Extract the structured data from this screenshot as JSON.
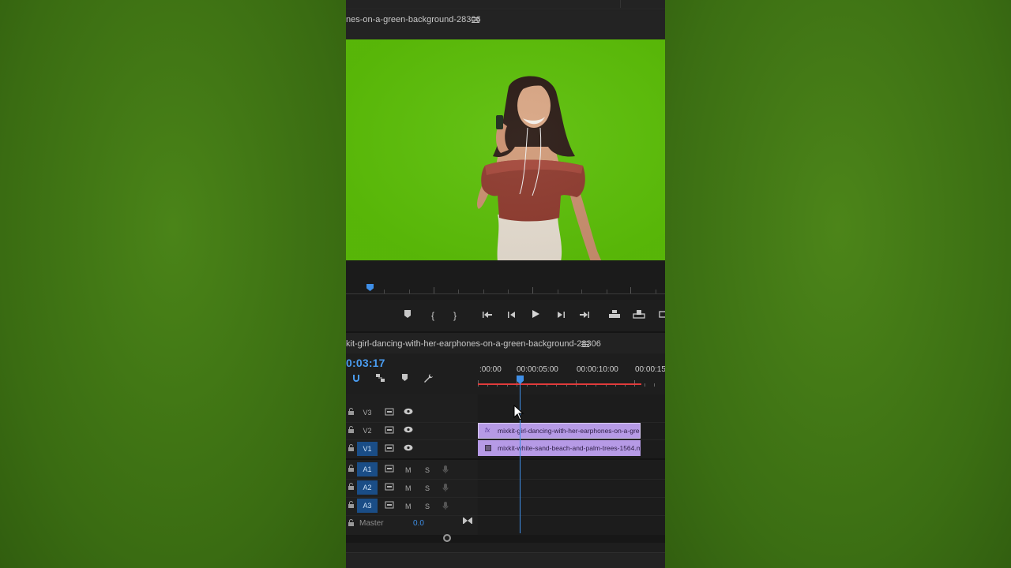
{
  "program_monitor": {
    "title": "nes-on-a-green-background-28306"
  },
  "timeline": {
    "title": "kit-girl-dancing-with-her-earphones-on-a-green-background-28306",
    "timecode": "0:03:17",
    "ruler_labels": [
      ":00:00",
      "00:00:05:00",
      "00:00:10:00",
      "00:00:15"
    ],
    "tracks": [
      {
        "label": "V3",
        "active": false,
        "type": "video"
      },
      {
        "label": "V2",
        "active": false,
        "type": "video"
      },
      {
        "label": "V1",
        "active": true,
        "type": "video"
      },
      {
        "label": "A1",
        "active": true,
        "type": "audio"
      },
      {
        "label": "A2",
        "active": true,
        "type": "audio"
      },
      {
        "label": "A3",
        "active": true,
        "type": "audio"
      }
    ],
    "mute_label": "M",
    "solo_label": "S",
    "clips": [
      {
        "track": "V2",
        "name": "mixkit-girl-dancing-with-her-earphones-on-a-gree",
        "badge": "fx"
      },
      {
        "track": "V1",
        "name": "mixkit-white-sand-beach-and-palm-trees-1564.mp"
      }
    ],
    "master": {
      "label": "Master",
      "value": "0.0"
    }
  },
  "colors": {
    "accent_blue": "#3f8fe8",
    "clip_purple": "#b69ae6",
    "green_screen": "#5cbf08",
    "work_area_red": "#e03b3b"
  },
  "icons": [
    "menu-icon",
    "marker-icon",
    "in-point-icon",
    "out-point-icon",
    "go-to-in-icon",
    "step-back-icon",
    "play-icon",
    "step-forward-icon",
    "go-to-out-icon",
    "insert-icon",
    "overwrite-icon",
    "export-frame-icon",
    "snap-icon",
    "linked-selection-icon",
    "add-marker-icon",
    "wrench-icon",
    "lock-icon",
    "toggle-output-icon",
    "eye-icon",
    "mic-icon",
    "scroll-knob-icon"
  ]
}
